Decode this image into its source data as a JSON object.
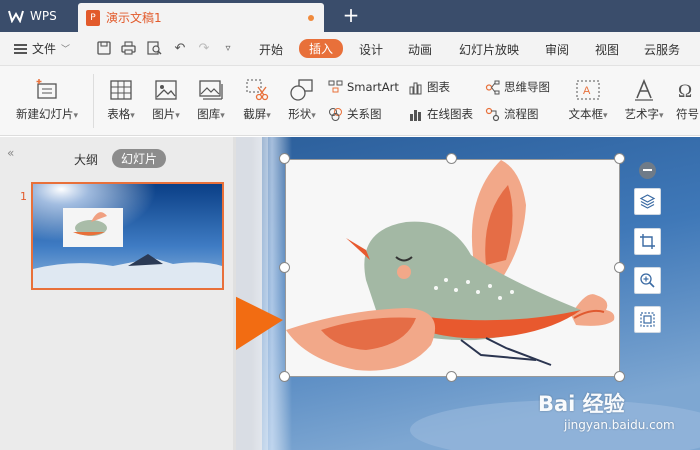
{
  "app": {
    "logo_text": "WPS"
  },
  "tab": {
    "title": "演示文稿1",
    "icon_letter": "P"
  },
  "menu": {
    "file_label": "文件",
    "items": [
      "开始",
      "插入",
      "设计",
      "动画",
      "幻灯片放映",
      "审阅",
      "视图",
      "云服务"
    ],
    "active": "插入"
  },
  "ribbon": {
    "new_slide": "新建幻灯片",
    "table": "表格",
    "picture": "图片",
    "gallery": "图库",
    "screenshot": "截屏",
    "shape": "形状",
    "smartart": "SmartArt",
    "relation": "关系图",
    "chart": "图表",
    "online_chart": "在线图表",
    "mindmap": "思维导图",
    "flowchart": "流程图",
    "textbox": "文本框",
    "wordart": "艺术字",
    "symbol": "符号"
  },
  "panel": {
    "outline_label": "大纲",
    "slides_label": "幻灯片",
    "slide_number": "1"
  },
  "watermark": {
    "brand": "Bai 经验",
    "url": "jingyan.baidu.com"
  },
  "colors": {
    "accent": "#e8703a",
    "titlebar": "#3a4d6b",
    "arrow": "#f26c12"
  }
}
